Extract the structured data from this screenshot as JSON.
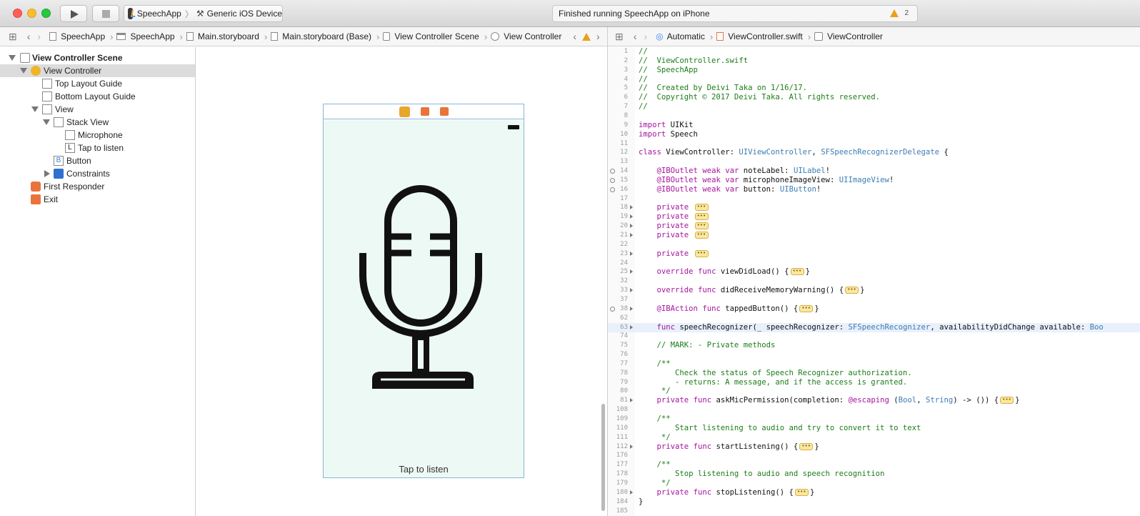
{
  "toolbar": {
    "scheme_app": "SpeechApp",
    "scheme_device": "Generic iOS Device",
    "status_text": "Finished running SpeechApp on iPhone",
    "warning_count": "2"
  },
  "left_jumpbar": {
    "items": [
      "SpeechApp",
      "SpeechApp",
      "Main.storyboard",
      "Main.storyboard (Base)",
      "View Controller Scene",
      "View Controller"
    ]
  },
  "right_jumpbar": {
    "items": [
      "Automatic",
      "ViewController.swift",
      "ViewController"
    ]
  },
  "outline": {
    "items": [
      {
        "label": "View Controller Scene"
      },
      {
        "label": "View Controller"
      },
      {
        "label": "Top Layout Guide"
      },
      {
        "label": "Bottom Layout Guide"
      },
      {
        "label": "View"
      },
      {
        "label": "Stack View"
      },
      {
        "label": "Microphone"
      },
      {
        "label": "Tap to listen"
      },
      {
        "label": "Button"
      },
      {
        "label": "Constraints"
      },
      {
        "label": "First Responder"
      },
      {
        "label": "Exit"
      }
    ]
  },
  "canvas": {
    "label_text": "Tap to listen"
  },
  "code": {
    "lines": [
      {
        "n": "1",
        "t": "//"
      },
      {
        "n": "2",
        "t": "//  ViewController.swift"
      },
      {
        "n": "3",
        "t": "//  SpeechApp"
      },
      {
        "n": "4",
        "t": "//"
      },
      {
        "n": "5",
        "t": "//  Created by Deivi Taka on 1/16/17."
      },
      {
        "n": "6",
        "t": "//  Copyright © 2017 Deivi Taka. All rights reserved."
      },
      {
        "n": "7",
        "t": "//"
      },
      {
        "n": "8",
        "t": ""
      },
      {
        "n": "9",
        "t": "import UIKit"
      },
      {
        "n": "10",
        "t": "import Speech"
      },
      {
        "n": "11",
        "t": ""
      },
      {
        "n": "12",
        "t": "class ViewController: UIViewController, SFSpeechRecognizerDelegate {"
      },
      {
        "n": "13",
        "t": ""
      },
      {
        "n": "14",
        "t": "    @IBOutlet weak var noteLabel: UILabel!"
      },
      {
        "n": "15",
        "t": "    @IBOutlet weak var microphoneImageView: UIImageView!"
      },
      {
        "n": "16",
        "t": "    @IBOutlet weak var button: UIButton!"
      },
      {
        "n": "17",
        "t": ""
      },
      {
        "n": "18",
        "t": "    private "
      },
      {
        "n": "19",
        "t": "    private "
      },
      {
        "n": "20",
        "t": "    private "
      },
      {
        "n": "21",
        "t": "    private "
      },
      {
        "n": "22",
        "t": ""
      },
      {
        "n": "23",
        "t": "    private "
      },
      {
        "n": "24",
        "t": ""
      },
      {
        "n": "25",
        "t": "    override func viewDidLoad() {"
      },
      {
        "n": "32",
        "t": ""
      },
      {
        "n": "33",
        "t": "    override func didReceiveMemoryWarning() {"
      },
      {
        "n": "37",
        "t": ""
      },
      {
        "n": "38",
        "t": "    @IBAction func tappedButton() {"
      },
      {
        "n": "62",
        "t": ""
      },
      {
        "n": "63",
        "t": "    func speechRecognizer(_ speechRecognizer: SFSpeechRecognizer, availabilityDidChange available: Boo"
      },
      {
        "n": "74",
        "t": ""
      },
      {
        "n": "75",
        "t": "    // MARK: - Private methods"
      },
      {
        "n": "76",
        "t": ""
      },
      {
        "n": "77",
        "t": "    /**"
      },
      {
        "n": "78",
        "t": "        Check the status of Speech Recognizer authorization."
      },
      {
        "n": "79",
        "t": "        - returns: A message, and if the access is granted."
      },
      {
        "n": "80",
        "t": "     */"
      },
      {
        "n": "81",
        "t": "    private func askMicPermission(completion: @escaping (Bool, String) -> ()) {"
      },
      {
        "n": "108",
        "t": ""
      },
      {
        "n": "109",
        "t": "    /**"
      },
      {
        "n": "110",
        "t": "        Start listening to audio and try to convert it to text"
      },
      {
        "n": "111",
        "t": "     */"
      },
      {
        "n": "112",
        "t": "    private func startListening() {"
      },
      {
        "n": "176",
        "t": ""
      },
      {
        "n": "177",
        "t": "    /**"
      },
      {
        "n": "178",
        "t": "        Stop listening to audio and speech recognition"
      },
      {
        "n": "179",
        "t": "     */"
      },
      {
        "n": "180",
        "t": "    private func stopListening() {"
      },
      {
        "n": "184",
        "t": "}"
      },
      {
        "n": "185",
        "t": ""
      }
    ]
  }
}
